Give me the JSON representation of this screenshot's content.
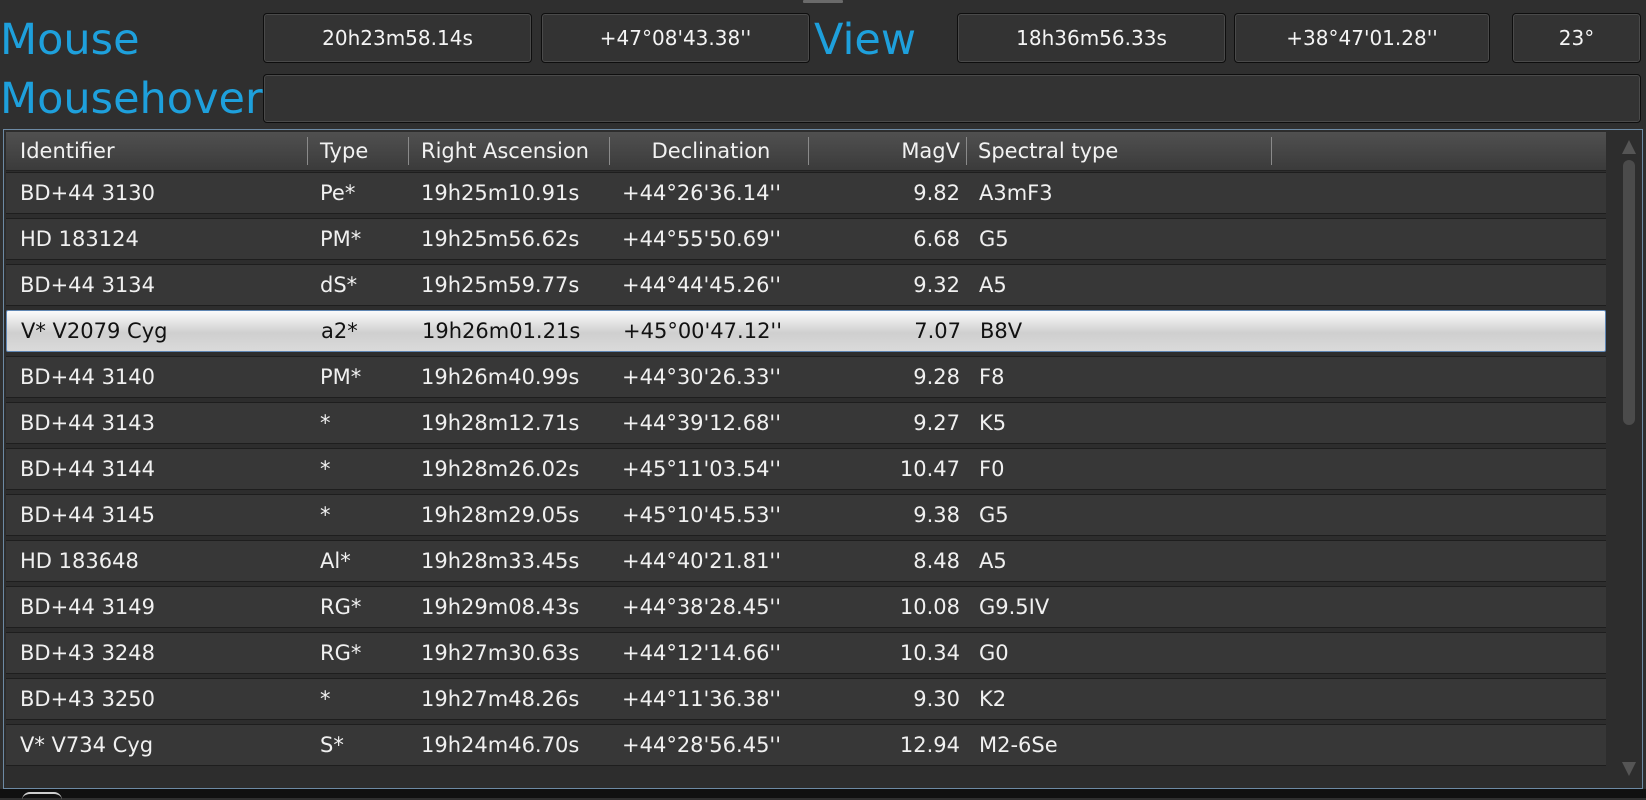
{
  "coords": {
    "mouse_label": "Mouse",
    "mouse_ra": "20h23m58.14s",
    "mouse_dec": "+47°08'43.38''",
    "view_label": "View",
    "view_ra": "18h36m56.33s",
    "view_dec": "+38°47'01.28''",
    "view_fov": "23°",
    "mousehover_label": "Mousehover",
    "mousehover_value": ""
  },
  "colors": {
    "label_accent": "#1ea0dc",
    "selection_border": "#5f86b3"
  },
  "table": {
    "columns": [
      "Identifier",
      "Type",
      "Right Ascension",
      "Declination",
      "MagV",
      "Spectral type"
    ],
    "selected_index": 3,
    "rows": [
      [
        "BD+44 3130",
        "Pe*",
        "19h25m10.91s",
        "+44°26'36.14''",
        "9.82",
        "A3mF3"
      ],
      [
        "HD 183124",
        "PM*",
        "19h25m56.62s",
        "+44°55'50.69''",
        "6.68",
        "G5"
      ],
      [
        "BD+44 3134",
        "dS*",
        "19h25m59.77s",
        "+44°44'45.26''",
        "9.32",
        "A5"
      ],
      [
        "V* V2079 Cyg",
        "a2*",
        "19h26m01.21s",
        "+45°00'47.12''",
        "7.07",
        "B8V"
      ],
      [
        "BD+44 3140",
        "PM*",
        "19h26m40.99s",
        "+44°30'26.33''",
        "9.28",
        "F8"
      ],
      [
        "BD+44 3143",
        "*",
        "19h28m12.71s",
        "+44°39'12.68''",
        "9.27",
        "K5"
      ],
      [
        "BD+44 3144",
        "*",
        "19h28m26.02s",
        "+45°11'03.54''",
        "10.47",
        "F0"
      ],
      [
        "BD+44 3145",
        "*",
        "19h28m29.05s",
        "+45°10'45.53''",
        "9.38",
        "G5"
      ],
      [
        "HD 183648",
        "Al*",
        "19h28m33.45s",
        "+44°40'21.81''",
        "8.48",
        "A5"
      ],
      [
        "BD+44 3149",
        "RG*",
        "19h29m08.43s",
        "+44°38'28.45''",
        "10.08",
        "G9.5IV"
      ],
      [
        "BD+43 3248",
        "RG*",
        "19h27m30.63s",
        "+44°12'14.66''",
        "10.34",
        "G0"
      ],
      [
        "BD+43 3250",
        "*",
        "19h27m48.26s",
        "+44°11'36.38''",
        "9.30",
        "K2"
      ],
      [
        "V* V734 Cyg",
        "S*",
        "19h24m46.70s",
        "+44°28'56.45''",
        "12.94",
        "M2-6Se"
      ]
    ]
  }
}
